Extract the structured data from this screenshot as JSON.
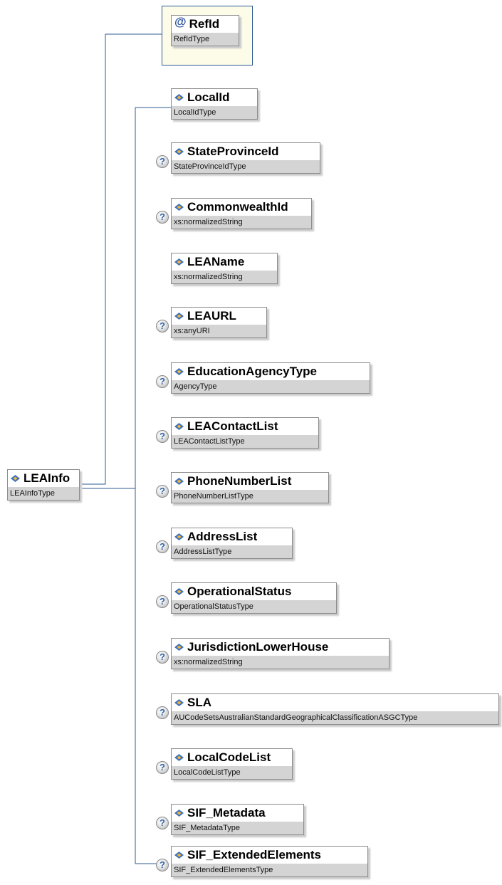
{
  "root": {
    "name": "LEAInfo",
    "type": "LEAInfoType"
  },
  "attribute": {
    "symbol": "@",
    "name": "RefId",
    "type": "RefIdType"
  },
  "elements": [
    {
      "name": "LocalId",
      "type": "LocalIdType",
      "optional": false
    },
    {
      "name": "StateProvinceId",
      "type": "StateProvinceIdType",
      "optional": true
    },
    {
      "name": "CommonwealthId",
      "type": "xs:normalizedString",
      "optional": true
    },
    {
      "name": "LEAName",
      "type": "xs:normalizedString",
      "optional": false
    },
    {
      "name": "LEAURL",
      "type": "xs:anyURI",
      "optional": true
    },
    {
      "name": "EducationAgencyType",
      "type": "AgencyType",
      "optional": true
    },
    {
      "name": "LEAContactList",
      "type": "LEAContactListType",
      "optional": true
    },
    {
      "name": "PhoneNumberList",
      "type": "PhoneNumberListType",
      "optional": true
    },
    {
      "name": "AddressList",
      "type": "AddressListType",
      "optional": true
    },
    {
      "name": "OperationalStatus",
      "type": "OperationalStatusType",
      "optional": true
    },
    {
      "name": "JurisdictionLowerHouse",
      "type": "xs:normalizedString",
      "optional": true
    },
    {
      "name": "SLA",
      "type": "AUCodeSetsAustralianStandardGeographicalClassificationASGCType",
      "optional": true
    },
    {
      "name": "LocalCodeList",
      "type": "LocalCodeListType",
      "optional": true
    },
    {
      "name": "SIF_Metadata",
      "type": "SIF_MetadataType",
      "optional": true
    },
    {
      "name": "SIF_ExtendedElements",
      "type": "SIF_ExtendedElementsType",
      "optional": true
    }
  ],
  "optional_marker": "?",
  "colors": {
    "connector": "#2c5b96",
    "attribute_frame_bg": "#fdfce8",
    "type_bar": "#d4d4d4",
    "optional_glyph": "#3466a8"
  }
}
